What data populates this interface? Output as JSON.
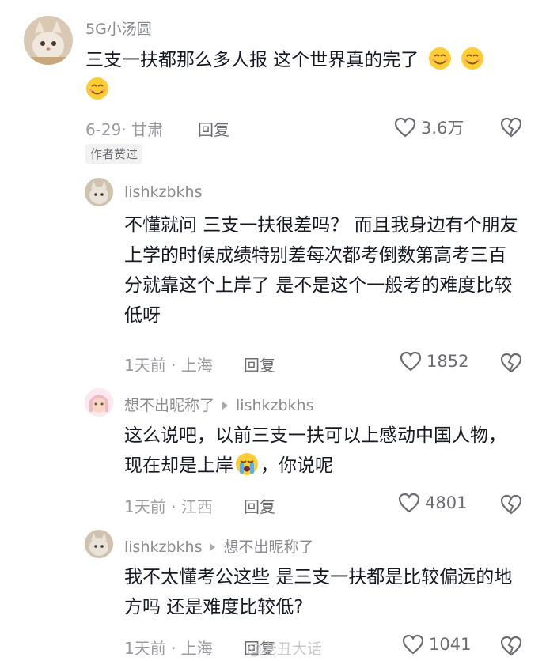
{
  "comments": [
    {
      "username": "5G小汤圆",
      "text": "三支一扶都那么多人报 这个世界真的完了",
      "emojis": [
        "smile-emoji",
        "smile-emoji",
        "smile-emoji"
      ],
      "meta": "6-29· 甘肃",
      "reply_label": "回复",
      "likes": "3.6万",
      "badge": "作者赞过"
    },
    {
      "username": "lishkzbkhs",
      "text": "不懂就问 三支一扶很差吗？ 而且我身边有个朋友上学的时候成绩特别差每次都考倒数第高考三百分就靠这个上岸了 是不是这个一般考的难度比较低呀",
      "meta": "1天前 · 上海",
      "reply_label": "回复",
      "likes": "1852"
    },
    {
      "username": "想不出昵称了",
      "reply_to": "lishkzbkhs",
      "text_part1": "这么说吧，以前三支一扶可以上感动中国人物，现在却是上岸",
      "emoji": "crying-emoji",
      "text_part2": "，你说呢",
      "meta": "1天前 · 江西",
      "reply_label": "回复",
      "likes": "4801"
    },
    {
      "username": "lishkzbkhs",
      "reply_to": "想不出昵称了",
      "text": "我不太懂考公这些 是三支一扶都是比较偏远的地方吗 还是难度比较低?",
      "meta": "1天前 · 上海",
      "reply_label": "回复",
      "likes": "1041"
    }
  ],
  "watermark": "@老丑大话",
  "colors": {
    "text": "#161823",
    "meta": "#9a9ba1",
    "username": "#8a8b91"
  }
}
